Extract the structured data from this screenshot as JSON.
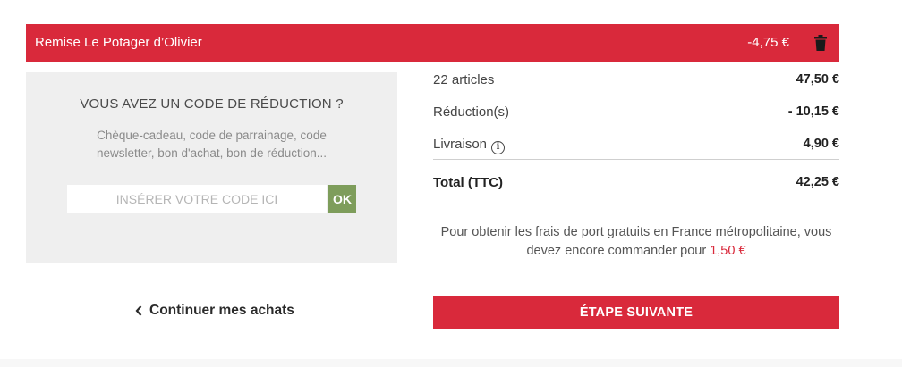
{
  "discount_banner": {
    "label": "Remise Le Potager d’Olivier",
    "amount": "-4,75 €",
    "delete_icon": "trash-icon"
  },
  "coupon": {
    "title": "VOUS AVEZ UN CODE DE RÉDUCTION ?",
    "subtitle": "Chèque-cadeau, code de parrainage, code newsletter, bon d'achat, bon de réduction...",
    "input_placeholder": "INSÉRER VOTRE CODE ICI",
    "input_value": "",
    "ok_label": "OK"
  },
  "summary": {
    "articles_label": "22 articles",
    "articles_value": "47,50 €",
    "reduction_label": "Réduction(s)",
    "reduction_value": "- 10,15 €",
    "delivery_label": "Livraison",
    "delivery_icon": "info-icon",
    "delivery_value": "4,90 €",
    "total_label": "Total (TTC)",
    "total_value": "42,25 €"
  },
  "shipping": {
    "text": "Pour obtenir les frais de port gratuits en France métropolitaine, vous devez encore commander pour",
    "remaining": "1,50 €"
  },
  "actions": {
    "continue_label": "Continuer mes achats",
    "next_label": "ÉTAPE SUIVANTE"
  },
  "colors": {
    "accent": "#d9293b",
    "ok_button": "#7e9d5b",
    "coupon_bg": "#efefef"
  }
}
